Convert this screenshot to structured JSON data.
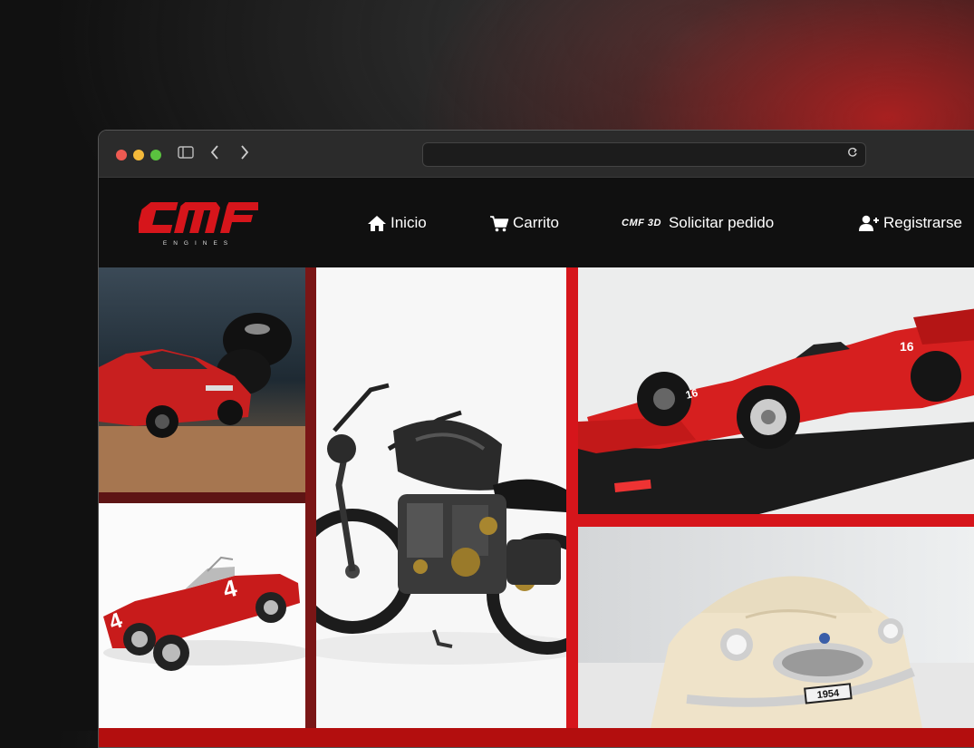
{
  "brand": {
    "name": "CMF",
    "tagline": "ENGINES"
  },
  "nav": {
    "items": [
      {
        "label": "Inicio",
        "icon": "home-icon"
      },
      {
        "label": "Carrito",
        "icon": "cart-icon"
      },
      {
        "label": "Solicitar pedido",
        "icon": "cmf-3d-logo",
        "prefix": "CMF 3D"
      },
      {
        "label": "Registrarse",
        "icon": "user-plus-icon"
      }
    ]
  },
  "gallery": {
    "plate_text": "1954"
  },
  "colors": {
    "brand_red": "#d6151b",
    "navbar_bg": "#101010",
    "gallery_frame": "#b30e0e"
  }
}
